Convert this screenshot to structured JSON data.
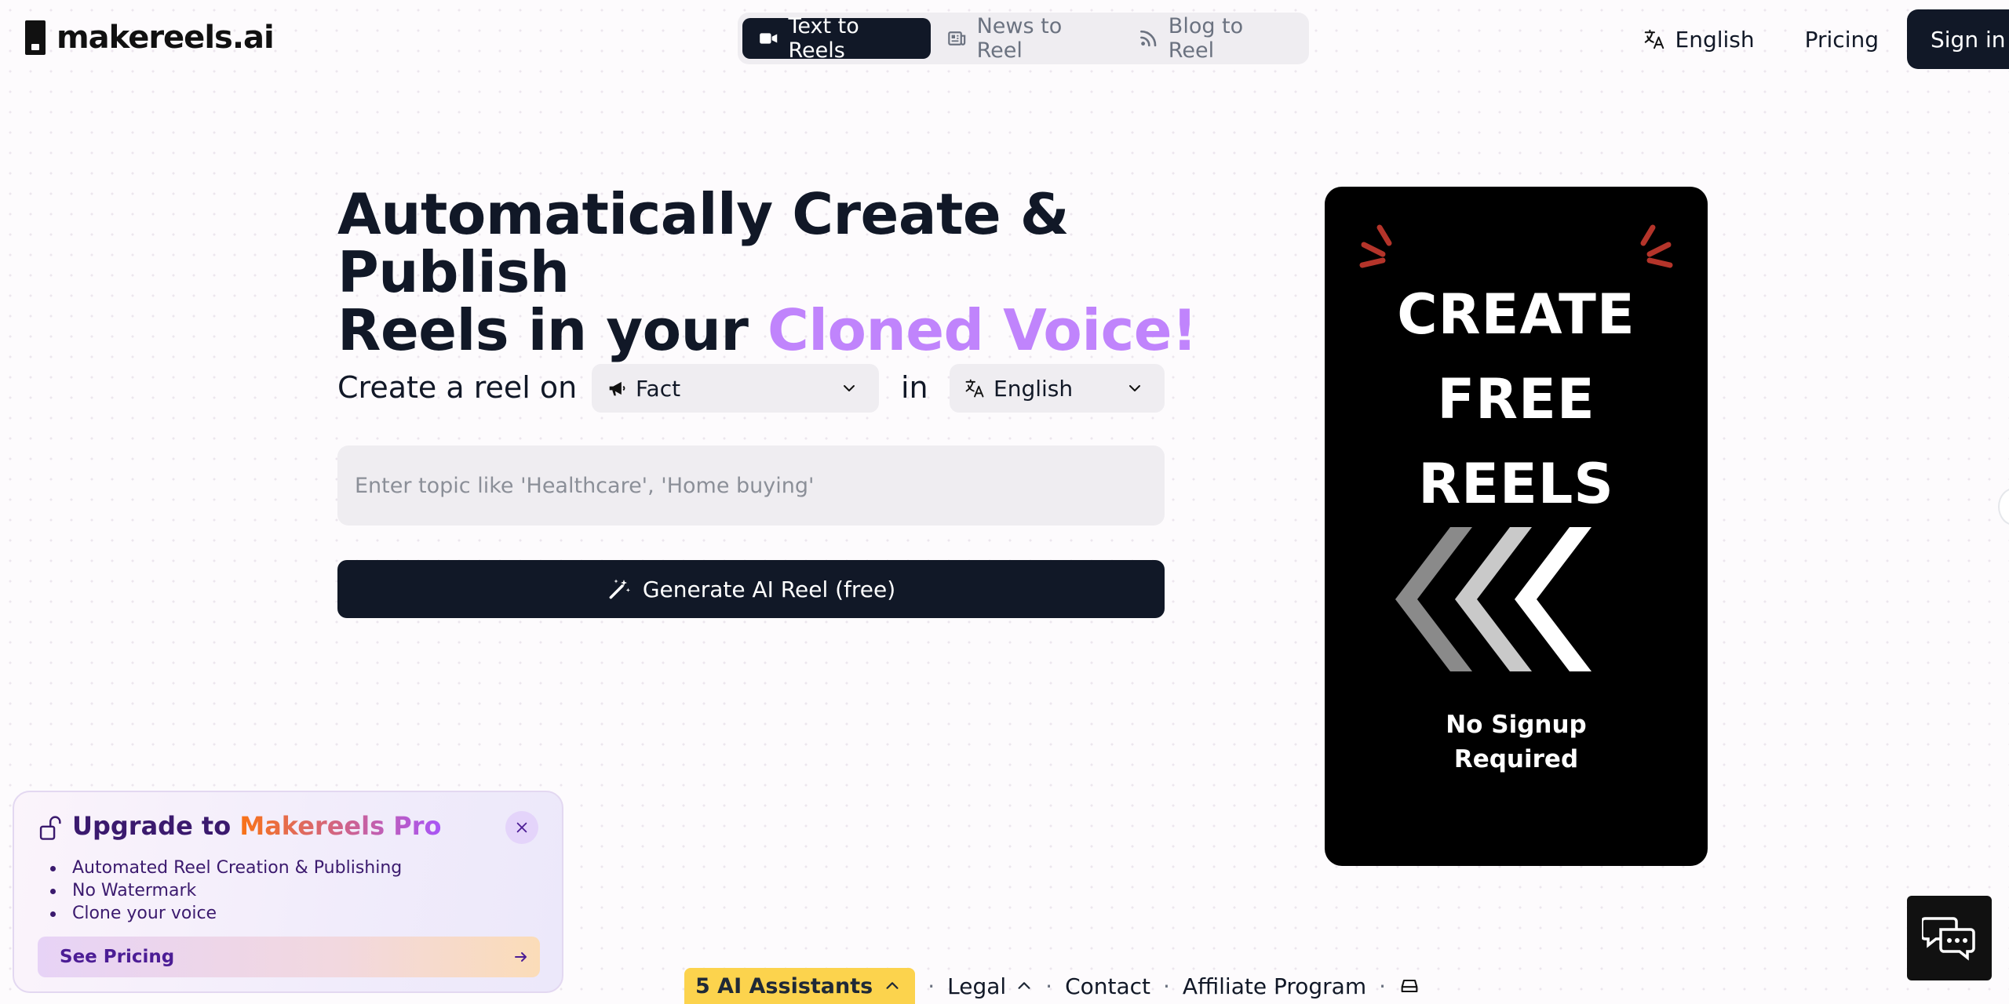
{
  "header": {
    "brand": "makereels.ai",
    "tabs": [
      {
        "label": "Text to Reels",
        "icon": "video-icon",
        "active": true
      },
      {
        "label": "News to Reel",
        "icon": "newspaper-icon",
        "active": false
      },
      {
        "label": "Blog to Reel",
        "icon": "rss-icon",
        "active": false
      }
    ],
    "language": "English",
    "pricing": "Pricing",
    "signin": "Sign in"
  },
  "hero": {
    "title_line1": "Automatically Create & Publish",
    "title_line2_prefix": "Reels in your ",
    "title_line2_accent": "Cloned Voice!",
    "create_label": "Create a reel on",
    "topic_select": "Fact",
    "in_label": "in",
    "language_select": "English",
    "topic_placeholder": "Enter topic like 'Healthcare', 'Home buying'",
    "generate_button": "Generate AI Reel (free)"
  },
  "promo": {
    "line1": "CREATE",
    "line2": "FREE",
    "line3": "REELS",
    "sub1": "No Signup",
    "sub2": "Required"
  },
  "upgrade": {
    "title_prefix": "Upgrade to ",
    "title_accent": "Makereels Pro",
    "features": [
      "Automated Reel Creation & Publishing",
      "No Watermark",
      "Clone your voice"
    ],
    "cta": "See Pricing"
  },
  "footer": {
    "ai_assistants": "5 AI Assistants",
    "legal": "Legal",
    "contact": "Contact",
    "affiliate": "Affiliate Program"
  },
  "colors": {
    "accent": "#c084fc",
    "dark": "#111827",
    "badge": "#fcd34d"
  }
}
